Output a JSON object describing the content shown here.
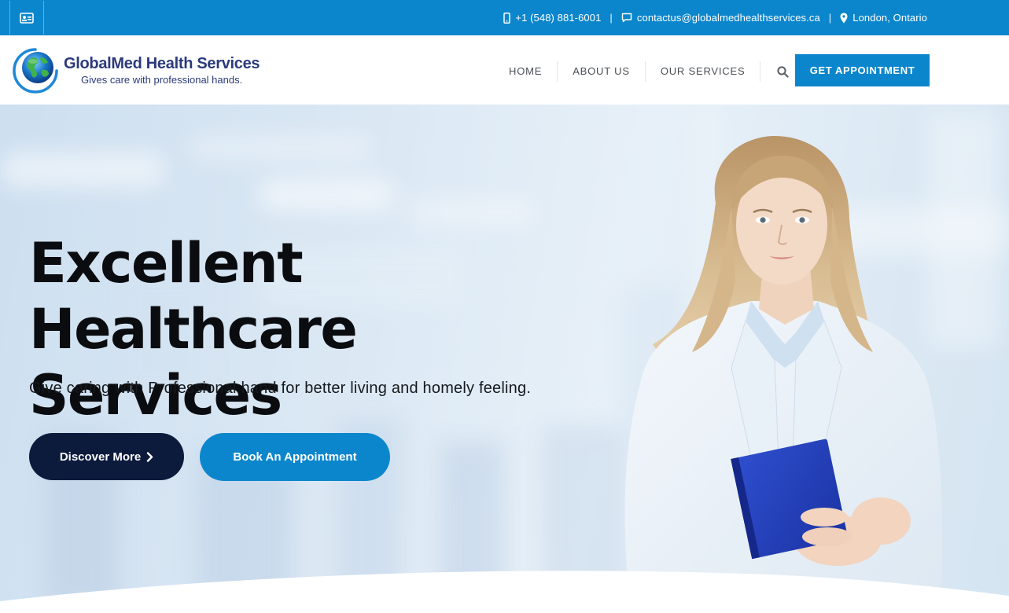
{
  "topbar": {
    "phone": "+1 (548) 881-6001",
    "email": "contactus@globalmedhealthservices.ca",
    "location": "London, Ontario",
    "separator": "|",
    "icons": {
      "toggle": "id-card-icon",
      "phone": "mobile-phone-icon",
      "email": "chat-bubble-icon",
      "location": "map-pin-icon"
    }
  },
  "header": {
    "logo": {
      "title": "GlobalMed Health Services",
      "tagline": "Gives care with professional hands."
    },
    "nav": [
      {
        "label": "HOME"
      },
      {
        "label": "ABOUT US"
      },
      {
        "label": "OUR SERVICES"
      }
    ],
    "search_icon": "search-icon",
    "cta_label": "GET APPOINTMENT"
  },
  "hero": {
    "heading_line1": "Excellent Healthcare",
    "heading_line2": "Services",
    "subheading": "Give caring with Professional hand for better living and homely feeling.",
    "discover_label": "Discover More",
    "discover_icon": "chevron-right-icon",
    "book_label": "Book An Appointment"
  },
  "colors": {
    "brand_blue": "#0b86cc",
    "navy": "#0c1a3c",
    "logo_text": "#2b3a7c"
  }
}
